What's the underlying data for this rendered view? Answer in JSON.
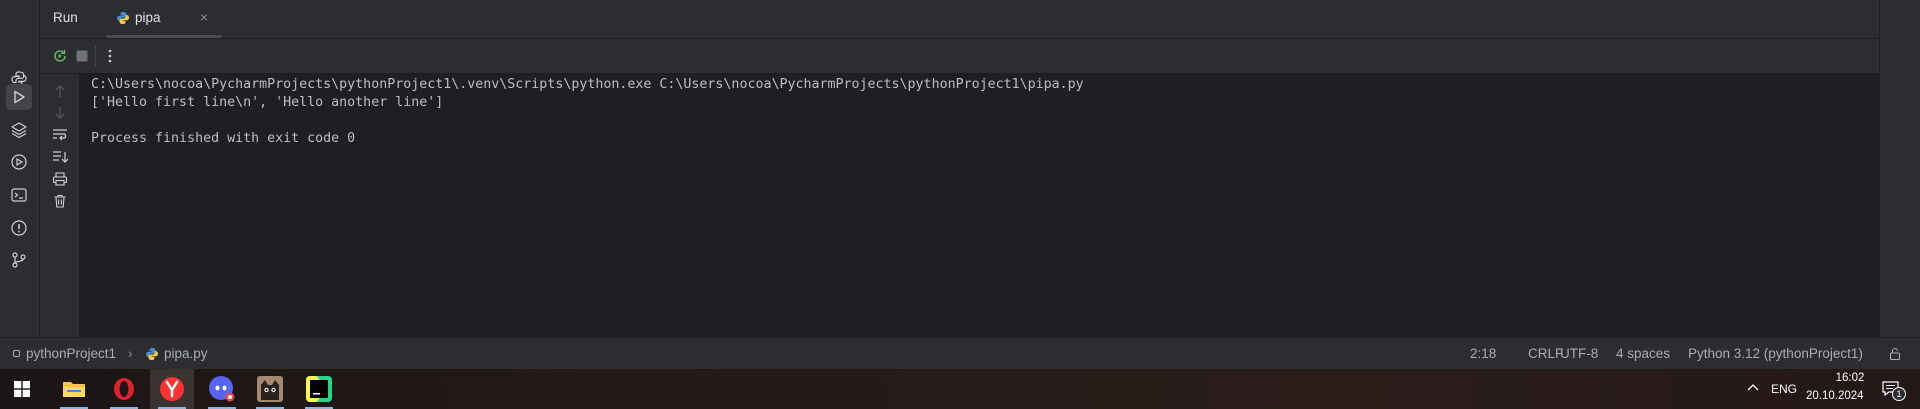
{
  "tool_window": {
    "title": "Run",
    "tabs": [
      {
        "label": "pipa",
        "icon": "python-file-icon",
        "close": "×"
      }
    ]
  },
  "left_strip_icons": [
    "python-console-icon",
    "run-icon",
    "layers-icon",
    "services-icon",
    "terminal-icon",
    "problems-icon",
    "git-icon"
  ],
  "toolbar_icons": [
    "rerun-icon",
    "stop-icon",
    "more-options-icon"
  ],
  "gutter_icons": [
    "scroll-up-icon",
    "scroll-down-icon",
    "soft-wrap-icon",
    "scroll-to-end-icon",
    "print-icon",
    "clear-all-icon"
  ],
  "console": {
    "lines": [
      "C:\\Users\\nocoa\\PycharmProjects\\pythonProject1\\.venv\\Scripts\\python.exe C:\\Users\\nocoa\\PycharmProjects\\pythonProject1\\pipa.py",
      "['Hello first line\\n', 'Hello another line']",
      "",
      "Process finished with exit code 0"
    ]
  },
  "status_bar": {
    "project": "pythonProject1",
    "separator": "›",
    "file": "pipa.py",
    "position": "2:18",
    "line_ending": "CRLF",
    "encoding": "UTF-8",
    "indent": "4 spaces",
    "interpreter": "Python 3.12 (pythonProject1)"
  },
  "taskbar": {
    "apps": [
      "windows-start-icon",
      "file-explorer-icon",
      "opera-icon",
      "yandex-browser-icon",
      "discord-icon",
      "cat-app-icon",
      "pycharm-icon"
    ],
    "language": "ENG",
    "time": "16:02",
    "date": "20.10.2024",
    "notification_count": "1"
  },
  "colors": {
    "panel": "#2b2d30",
    "editor": "#1e1f22",
    "text": "#bcbec4",
    "accent_green": "#5fb865"
  }
}
